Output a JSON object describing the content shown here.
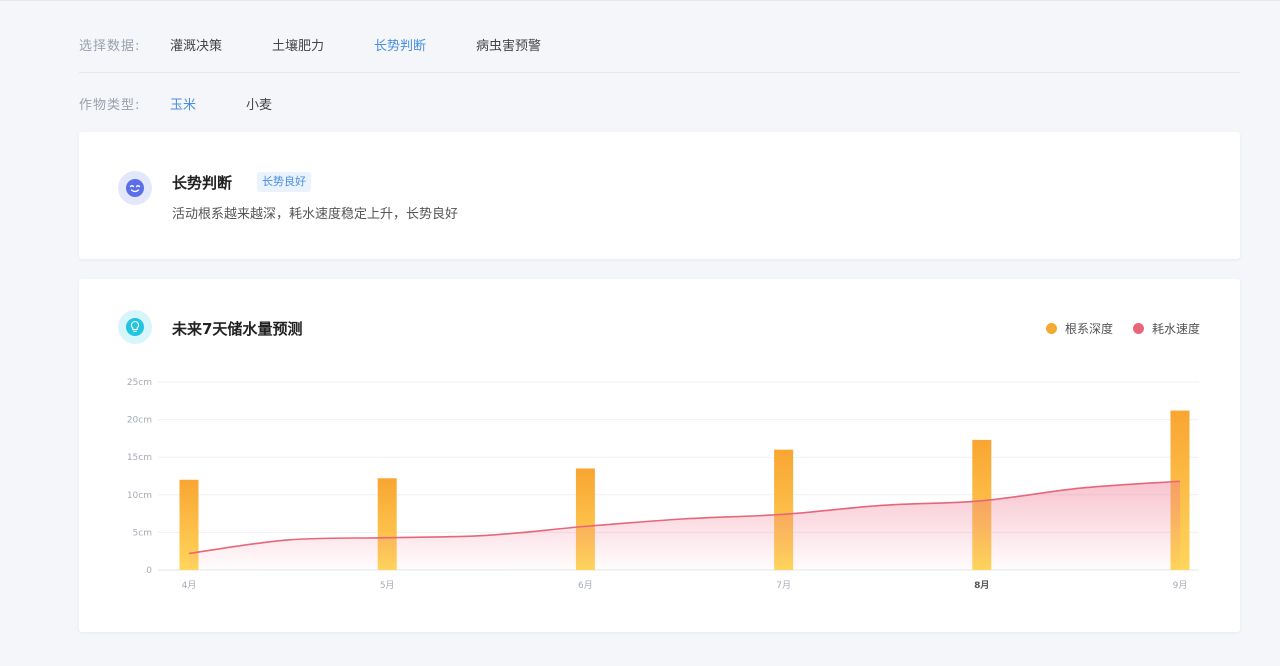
{
  "filters": {
    "data_label": "选择数据:",
    "data_options": [
      {
        "label": "灌溉决策",
        "active": false
      },
      {
        "label": "土壤肥力",
        "active": false
      },
      {
        "label": "长势判断",
        "active": true
      },
      {
        "label": "病虫害预警",
        "active": false
      }
    ],
    "crop_label": "作物类型:",
    "crop_options": [
      {
        "label": "玉米",
        "active": true
      },
      {
        "label": "小麦",
        "active": false
      }
    ]
  },
  "status_card": {
    "icon": "smile-face-icon",
    "title": "长势判断",
    "badge": "长势良好",
    "description": "活动根系越来越深，耗水速度稳定上升，长势良好"
  },
  "chart_card": {
    "icon": "lightbulb-icon",
    "title": "未来7天储水量预测"
  },
  "colors": {
    "accent": "#4a8fe0",
    "bar_top": "#f9a532",
    "bar_bottom": "#ffd65c",
    "line": "#e8667a"
  },
  "chart_data": {
    "type": "bar",
    "categories": [
      "4月",
      "5月",
      "6月",
      "7月",
      "8月",
      "9月"
    ],
    "highlight_category": "8月",
    "y_ticks": [
      "0",
      "5cm",
      "10cm",
      "15cm",
      "20cm",
      "25cm"
    ],
    "ylim": [
      0,
      25
    ],
    "grid": true,
    "legend_position": "top-right",
    "series": [
      {
        "name": "根系深度",
        "type": "bar",
        "color": "#f5a832",
        "values": [
          12,
          12.2,
          13.5,
          16,
          17.3,
          21.2
        ]
      },
      {
        "name": "耗水速度",
        "type": "area-line",
        "color": "#e8667a",
        "x": [
          0,
          0.5,
          1,
          1.5,
          2,
          2.5,
          3,
          3.5,
          4,
          4.5,
          5
        ],
        "values": [
          2.2,
          4,
          4.3,
          4.6,
          5.8,
          6.8,
          7.4,
          8.6,
          9.2,
          10.9,
          11.8
        ]
      }
    ]
  }
}
